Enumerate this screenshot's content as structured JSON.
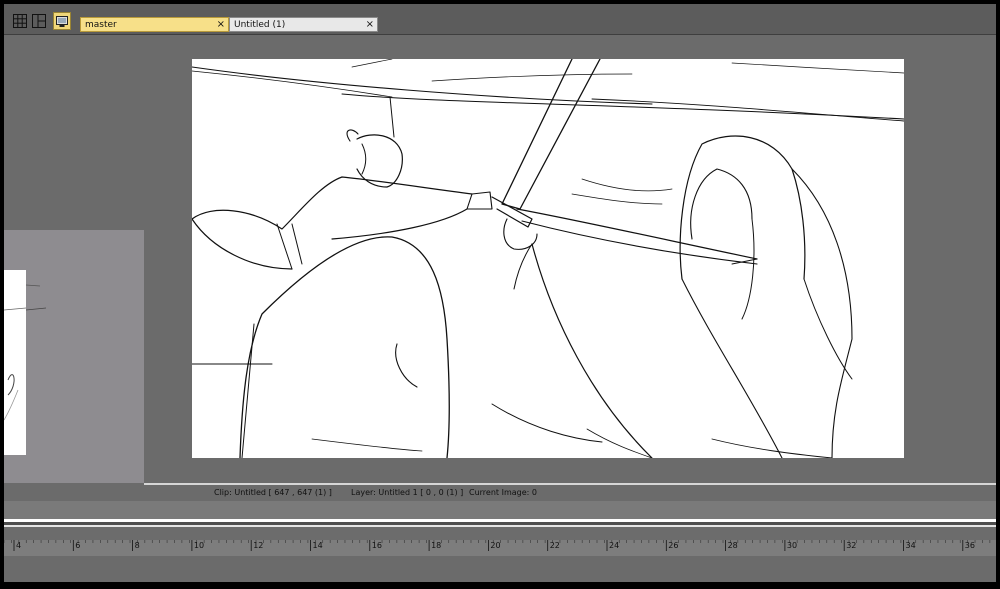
{
  "tabs": [
    {
      "label": "master",
      "active": true,
      "close": "×"
    },
    {
      "label": "Untitled (1)",
      "active": false,
      "close": "×"
    }
  ],
  "toolbar": {
    "icons": [
      "grid-view-icon",
      "layout-panels-icon",
      "monitor-icon"
    ]
  },
  "status": {
    "clip": "Clip: Untitled [ 647 , 647  (1) ]",
    "layer": "Layer: Untitled 1 [ 0 , 0  (1) ]",
    "current_image": "Current Image: 0"
  },
  "ruler": {
    "labels": [
      "4",
      "6",
      "8",
      "10",
      "12",
      "14",
      "16",
      "18",
      "20",
      "22",
      "24",
      "26",
      "28",
      "30",
      "32",
      "34",
      "36"
    ]
  },
  "colors": {
    "active_tab": "#f7e089",
    "inactive_tab": "#e8e8e8",
    "workspace": "#6b6b6b",
    "canvas": "#ffffff"
  }
}
